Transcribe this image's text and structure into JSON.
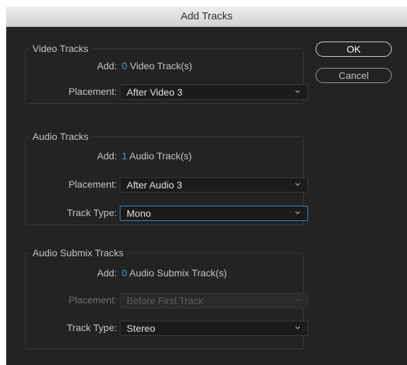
{
  "window": {
    "title": "Add Tracks"
  },
  "video": {
    "legend": "Video Tracks",
    "add_label": "Add:",
    "add_count": "0",
    "add_suffix": "Video Track(s)",
    "placement_label": "Placement:",
    "placement_value": "After Video 3"
  },
  "audio": {
    "legend": "Audio Tracks",
    "add_label": "Add:",
    "add_count": "1",
    "add_suffix": "Audio Track(s)",
    "placement_label": "Placement:",
    "placement_value": "After Audio 3",
    "tracktype_label": "Track Type:",
    "tracktype_value": "Mono"
  },
  "submix": {
    "legend": "Audio Submix Tracks",
    "add_label": "Add:",
    "add_count": "0",
    "add_suffix": "Audio Submix Track(s)",
    "placement_label": "Placement:",
    "placement_value": "Before First Track",
    "tracktype_label": "Track Type:",
    "tracktype_value": "Stereo"
  },
  "buttons": {
    "ok": "OK",
    "cancel": "Cancel"
  },
  "colors": {
    "accent": "#3aa0dc",
    "focus_border": "#2f8fd3",
    "background": "#232323"
  },
  "icons": {
    "dropdown": "chevron-down-icon"
  }
}
